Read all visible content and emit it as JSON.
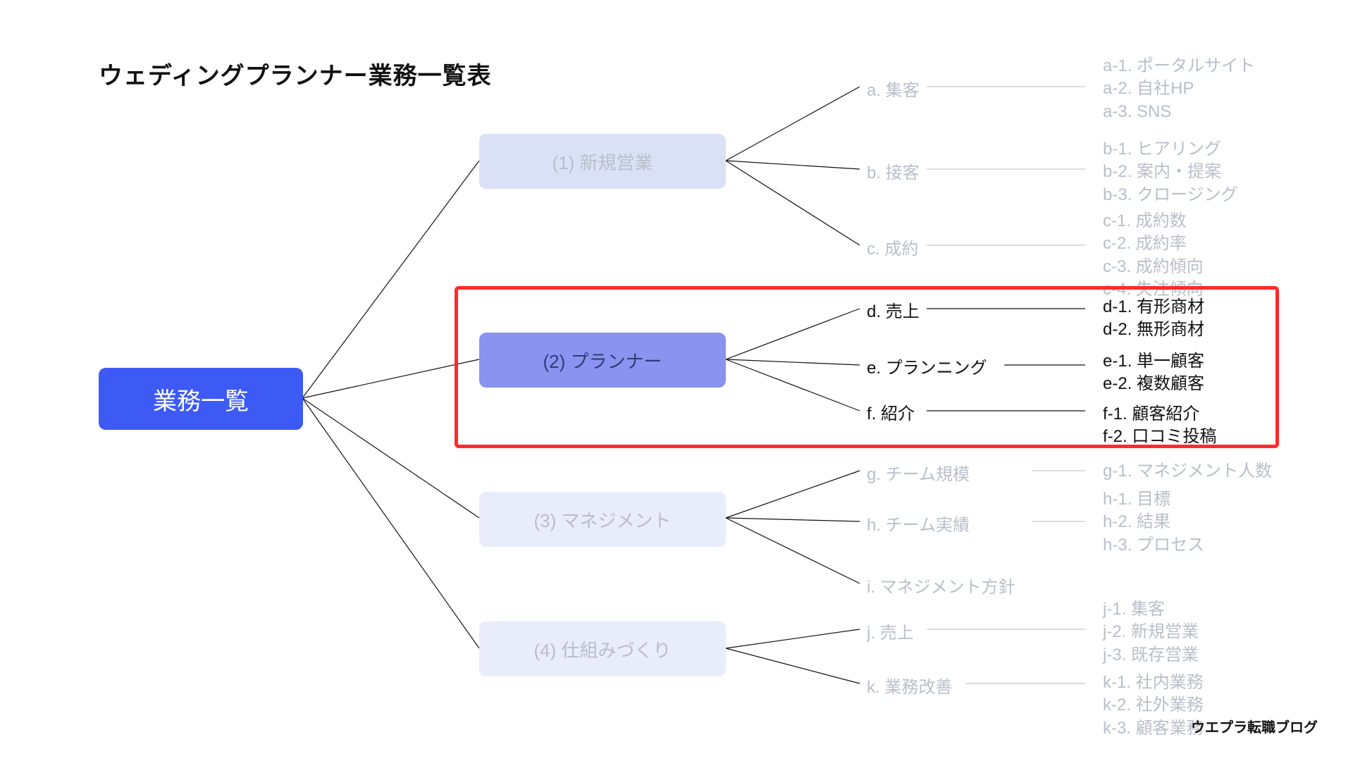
{
  "title": "ウェディングプランナー業務一覧表",
  "root_label": "業務一覧",
  "colors": {
    "root_bg": "#3d5af5",
    "root_text": "#ffffff",
    "cat_muted_bg": "#dae1f7",
    "cat_muted_text": "#b8bfc9",
    "cat_active_bg": "#8a93f0",
    "cat_active_text": "#313b72",
    "muted_text": "#b8bfc9",
    "sharp_text": "#111111",
    "highlight_border": "#ff2a2a"
  },
  "categories": [
    {
      "id": "1",
      "label": "(1) 新規営業",
      "active": false
    },
    {
      "id": "2",
      "label": "(2) プランナー",
      "active": true
    },
    {
      "id": "3",
      "label": "(3) マネジメント",
      "active": false
    },
    {
      "id": "4",
      "label": "(4) 仕組みづくり",
      "active": false
    }
  ],
  "mids": {
    "a": "a. 集客",
    "b": "b. 接客",
    "c": "c. 成約",
    "d": "d. 売上",
    "e": "e. プランニング",
    "f": "f. 紹介",
    "g": "g. チーム規模",
    "h": "h. チーム実績",
    "i": "i. マネジメント方針",
    "j": "j. 売上",
    "k": "k. 業務改善"
  },
  "leaves": {
    "a": [
      "a-1. ポータルサイト",
      "a-2. 自社HP",
      "a-3. SNS"
    ],
    "b": [
      "b-1. ヒアリング",
      "b-2. 案内・提案",
      "b-3. クロージング"
    ],
    "c": [
      "c-1. 成約数",
      "c-2. 成約率",
      "c-3. 成約傾向",
      "c-4. 失注傾向"
    ],
    "d": [
      "d-1. 有形商材",
      "d-2. 無形商材"
    ],
    "e": [
      "e-1. 単一顧客",
      "e-2. 複数顧客"
    ],
    "f": [
      "f-1. 顧客紹介",
      "f-2. 口コミ投稿"
    ],
    "g": [
      "g-1. マネジメント人数"
    ],
    "h": [
      "h-1. 目標",
      "h-2. 結果",
      "h-3. プロセス"
    ],
    "j": [
      "j-1. 集客",
      "j-2. 新規営業",
      "j-3. 既存営業"
    ],
    "k": [
      "k-1. 社内業務",
      "k-2. 社外業務",
      "k-3. 顧客業務"
    ]
  },
  "footer": "ウエプラ転職ブログ"
}
